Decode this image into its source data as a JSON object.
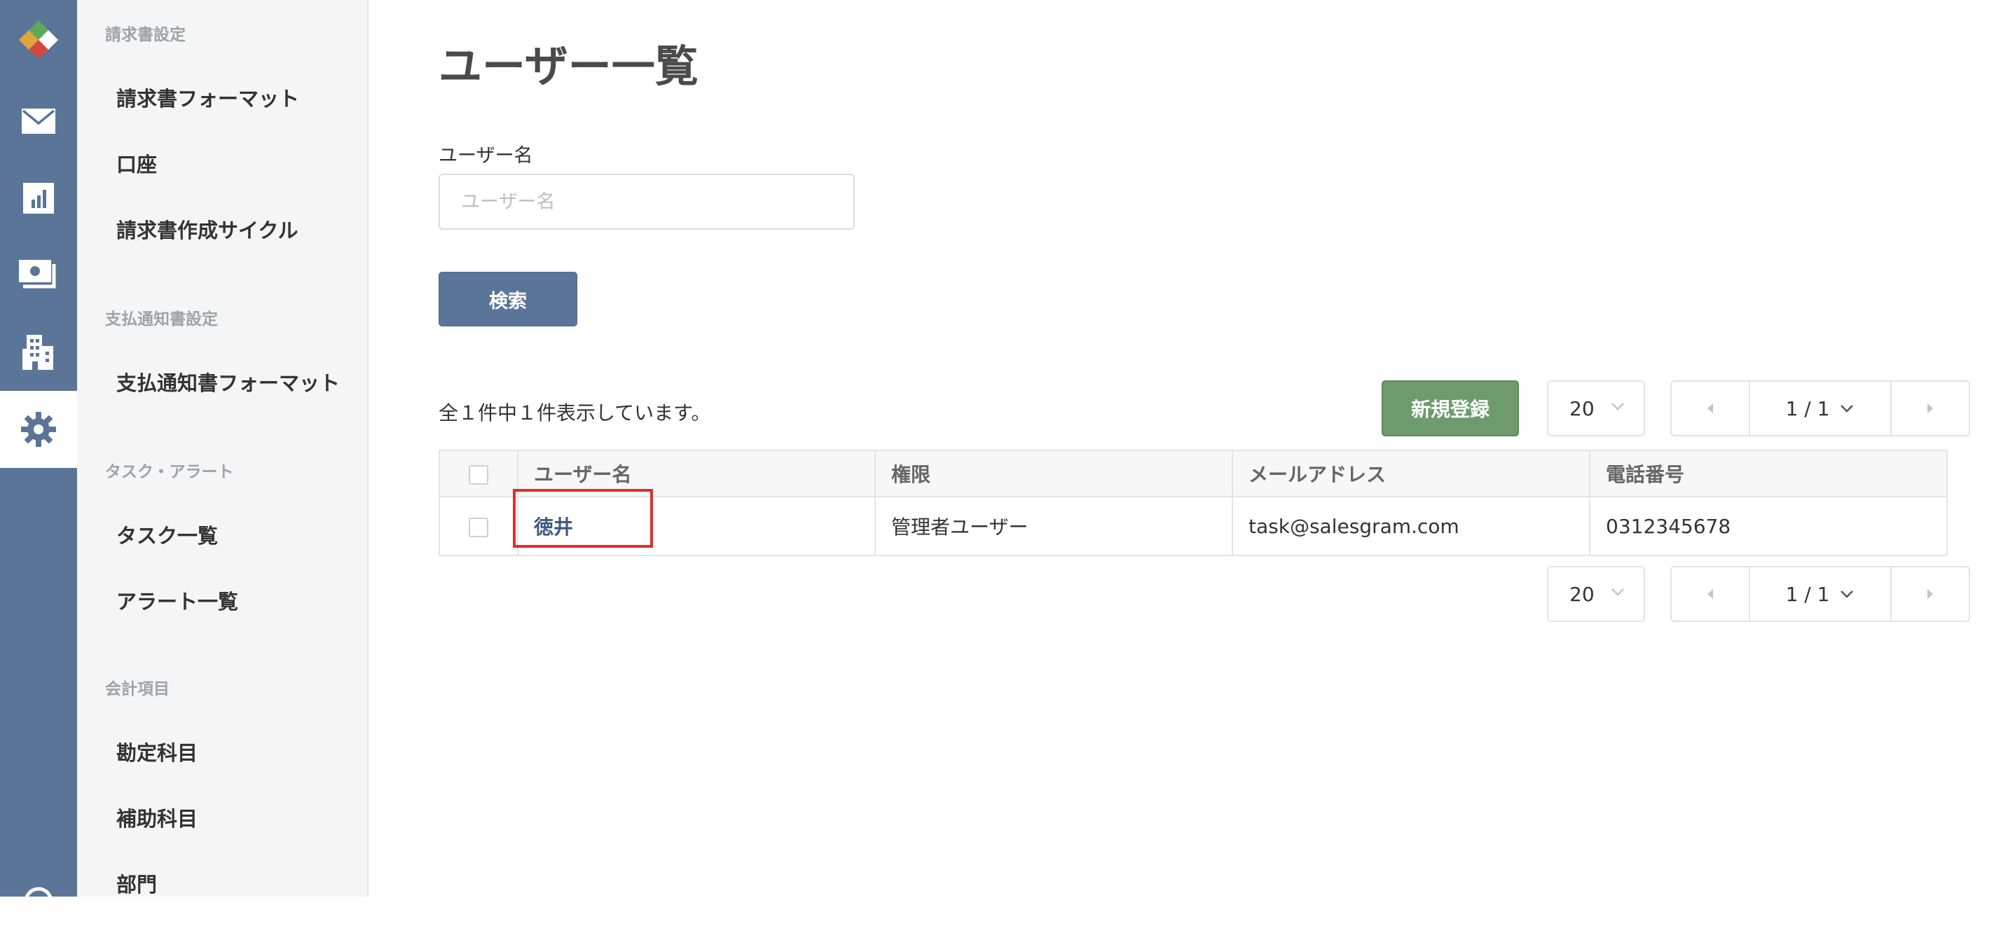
{
  "sidebar": {
    "rail_items": [
      {
        "icon": "app-logo-icon"
      },
      {
        "icon": "mail-icon"
      },
      {
        "icon": "bar-chart-icon"
      },
      {
        "icon": "invoice-icon"
      },
      {
        "icon": "building-icon"
      },
      {
        "icon": "gear-icon",
        "active": true
      },
      {
        "icon": "help-icon"
      }
    ],
    "sections": [
      {
        "header": "請求書設定",
        "items": [
          "請求書フォーマット",
          "口座",
          "請求書作成サイクル"
        ]
      },
      {
        "header": "支払通知書設定",
        "items": [
          "支払通知書フォーマット"
        ]
      },
      {
        "header": "タスク・アラート",
        "items": [
          "タスク一覧",
          "アラート一覧"
        ]
      },
      {
        "header": "会計項目",
        "items": [
          "勘定科目",
          "補助科目",
          "部門"
        ]
      }
    ]
  },
  "main": {
    "title": "ユーザー一覧",
    "search": {
      "label": "ユーザー名",
      "placeholder": "ユーザー名",
      "value": "",
      "button_label": "検索"
    },
    "result_summary": "全１件中１件表示しています。",
    "new_button_label": "新規登録",
    "page_size": "20",
    "page_indicator": "1 / 1",
    "table": {
      "columns": [
        "ユーザー名",
        "権限",
        "メールアドレス",
        "電話番号"
      ],
      "rows": [
        {
          "name": "徳井",
          "role": "管理者ユーザー",
          "email": "task@salesgram.com",
          "phone": "0312345678",
          "highlighted": true
        }
      ]
    }
  },
  "colors": {
    "rail": "#5b7598",
    "primary_button": "#5b7598",
    "new_button": "#6e9b6e",
    "highlight": "#d9322b",
    "link": "#3d5a80"
  }
}
